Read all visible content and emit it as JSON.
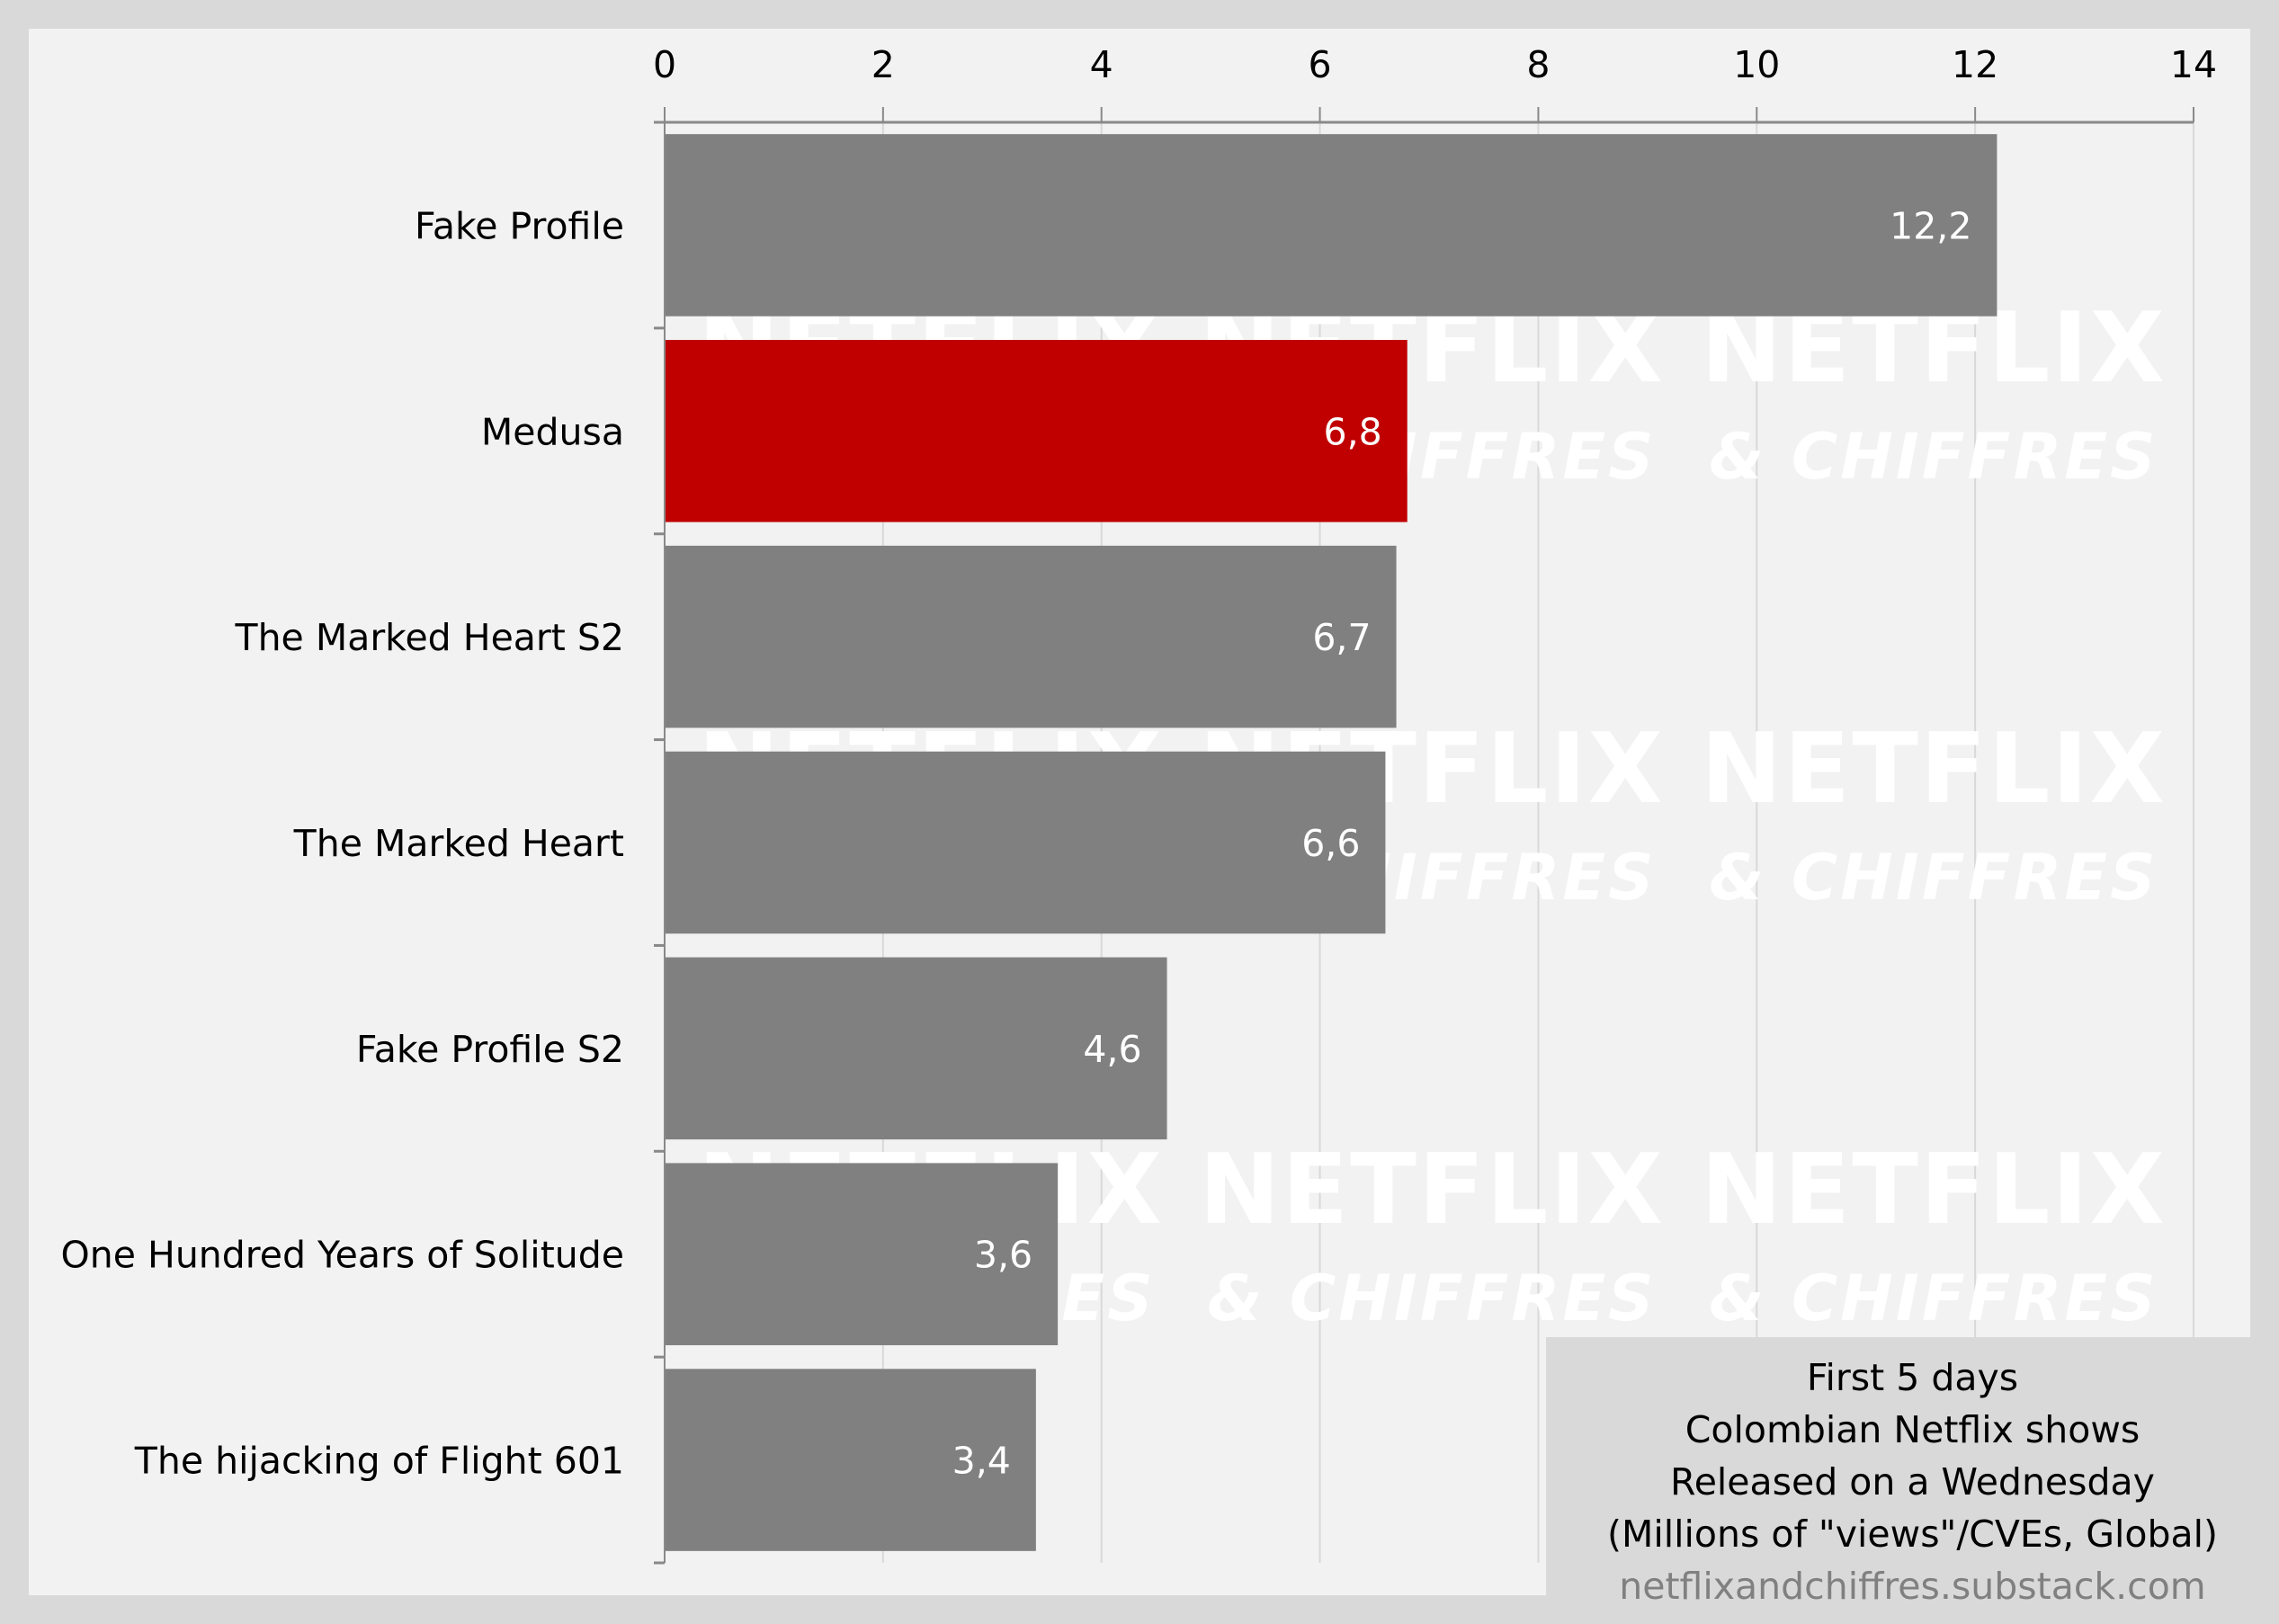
{
  "chart_data": {
    "type": "bar",
    "orientation": "horizontal",
    "categories": [
      "Fake Profile",
      "Medusa",
      "The Marked Heart S2",
      "The Marked Heart",
      "Fake Profile S2",
      "One Hundred Years of Solitude",
      "The hijacking of Flight 601"
    ],
    "values": [
      12.2,
      6.8,
      6.7,
      6.6,
      4.6,
      3.6,
      3.4
    ],
    "data_labels": [
      "12,2",
      "6,8",
      "6,7",
      "6,6",
      "4,6",
      "3,6",
      "3,4"
    ],
    "highlight": "Medusa",
    "colors": {
      "default": "#808080",
      "highlight": "#c00000",
      "grid": "#d9d9d9",
      "axis": "#898989",
      "label_on_bar": "#ffffff"
    },
    "xlim": [
      0,
      14
    ],
    "xticks": [
      0,
      2,
      4,
      6,
      8,
      10,
      12,
      14
    ],
    "xtick_labels": [
      "0",
      "2",
      "4",
      "6",
      "8",
      "10",
      "12",
      "14"
    ],
    "x_axis_position": "top",
    "grid": true,
    "title": "",
    "xlabel": "",
    "ylabel": ""
  },
  "annotation": {
    "lines": [
      "First 5 days",
      "Colombian Netflix shows",
      "Released on a Wednesday",
      "(Millions of \"views\"/CVEs, Global)"
    ],
    "source": "netflixandchiffres.substack.com"
  },
  "watermark": {
    "line1": "NETFLIX",
    "line2": "& CHIFFRES"
  }
}
